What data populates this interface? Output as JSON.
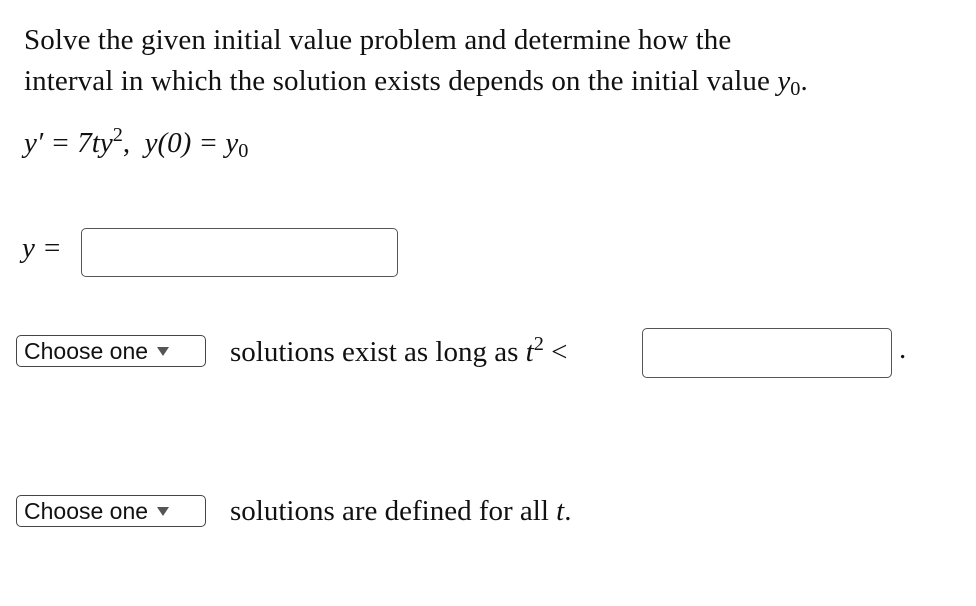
{
  "question": {
    "prompt_line_1": "Solve the given initial value problem and determine how the",
    "prompt_line_2_text": "interval in which the solution exists depends on the initial value ",
    "prompt_line_2_var": "y",
    "prompt_line_2_sub": "0",
    "prompt_line_2_end": "."
  },
  "equation": {
    "lhs": "y′ = 7ty",
    "lhs_exp": "2",
    "sep": ",  ",
    "ic": "y(0) = y",
    "ic_sub": "0"
  },
  "answer_y": {
    "label": "y =",
    "value": "",
    "placeholder": ""
  },
  "condition_1": {
    "dropdown_selected": "Choose one",
    "text_before": "solutions exist as long as ",
    "var": "t",
    "exp": "2",
    "op": " <",
    "input_value": "",
    "trailing": "."
  },
  "condition_2": {
    "dropdown_selected": "Choose one",
    "text_before": "solutions are defined for all ",
    "var": "t",
    "trailing": "."
  },
  "icons": {
    "dropdown_caret": "caret-down-icon"
  }
}
